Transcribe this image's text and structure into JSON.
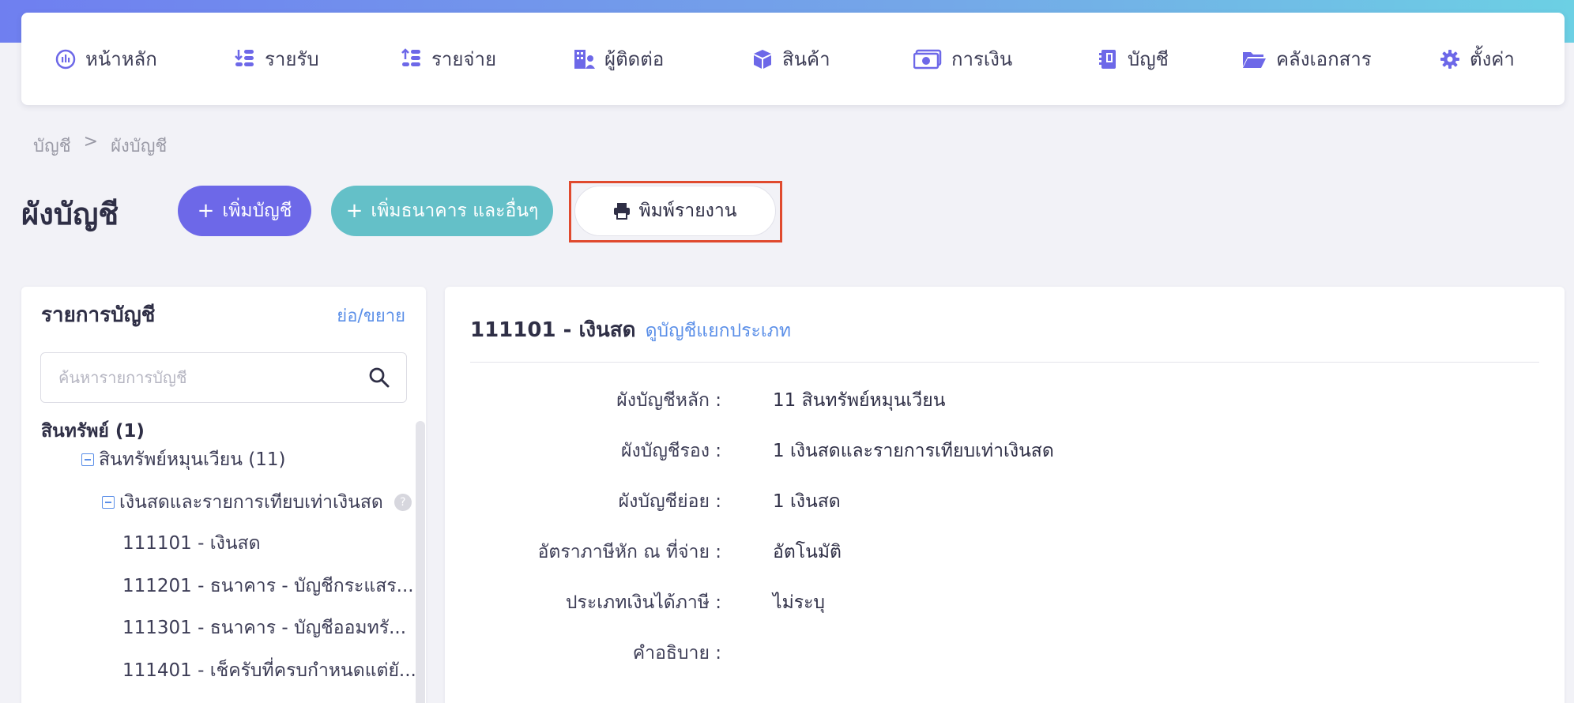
{
  "nav": {
    "items": [
      {
        "label": "หน้าหลัก",
        "icon": "dashboard-icon"
      },
      {
        "label": "รายรับ",
        "icon": "income-icon"
      },
      {
        "label": "รายจ่าย",
        "icon": "expense-icon"
      },
      {
        "label": "ผู้ติดต่อ",
        "icon": "contacts-icon"
      },
      {
        "label": "สินค้า",
        "icon": "box-icon"
      },
      {
        "label": "การเงิน",
        "icon": "money-icon"
      },
      {
        "label": "บัญชี",
        "icon": "ledger-book-icon"
      },
      {
        "label": "คลังเอกสาร",
        "icon": "folder-icon"
      },
      {
        "label": "ตั้งค่า",
        "icon": "gear-icon"
      }
    ]
  },
  "breadcrumb": {
    "parent": "บัญชี",
    "separator": ">",
    "current": "ผังบัญชี"
  },
  "page": {
    "title": "ผังบัญชี"
  },
  "actions": {
    "add_account": "เพิ่มบัญชี",
    "add_bank": "เพิ่มธนาคาร และอื่นๆ",
    "print_report": "พิมพ์รายงาน"
  },
  "account_list": {
    "title": "รายการบัญชี",
    "toggle": "ย่อ/ขยาย",
    "search_placeholder": "ค้นหารายการบัญชี",
    "search_value": "",
    "tree": {
      "root": "สินทรัพย์ (1)",
      "group": "สินทรัพย์หมุนเวียน (11)",
      "subgroup": "เงินสดและรายการเทียบเท่าเงินสด",
      "help": "?",
      "items": [
        "111101 - เงินสด",
        "111201 - ธนาคาร - บัญชีกระแสร...",
        "111301 - ธนาคาร - บัญชีออมทรั...",
        "111401 - เช็ครับที่ครบกำหนดแต่ยั..."
      ]
    }
  },
  "account_detail": {
    "account": "111101 - เงินสด",
    "ledger_link": "ดูบัญชีแยกประเภท",
    "fields": [
      {
        "label": "ผังบัญชีหลัก :",
        "value": "11 สินทรัพย์หมุนเวียน"
      },
      {
        "label": "ผังบัญชีรอง :",
        "value": "1 เงินสดและรายการเทียบเท่าเงินสด"
      },
      {
        "label": "ผังบัญชีย่อย :",
        "value": "1 เงินสด"
      },
      {
        "label": "อัตราภาษีหัก ณ ที่จ่าย :",
        "value": "อัตโนมัติ"
      },
      {
        "label": "ประเภทเงินได้ภาษี :",
        "value": "ไม่ระบุ"
      },
      {
        "label": "คำอธิบาย :",
        "value": ""
      }
    ]
  },
  "colors": {
    "primary": "#6d68e8",
    "teal": "#64c0c8",
    "link": "#5b8fe8",
    "highlight": "#e04a2e"
  }
}
